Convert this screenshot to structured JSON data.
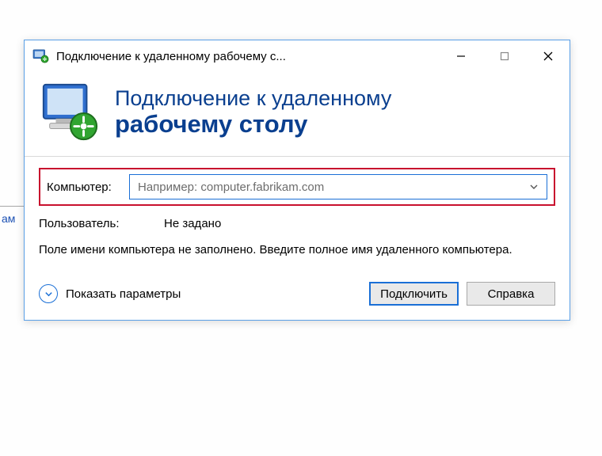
{
  "bg_fragment": "ам",
  "titlebar": {
    "title": "Подключение к удаленному рабочему с..."
  },
  "header": {
    "line1": "Подключение к удаленному",
    "line2": "рабочему столу"
  },
  "form": {
    "computer_label": "Компьютер:",
    "computer_placeholder": "Например: computer.fabrikam.com",
    "user_label": "Пользователь:",
    "user_value": "Не задано",
    "hint": "Поле имени компьютера не заполнено. Введите полное имя удаленного компьютера."
  },
  "footer": {
    "options_label": "Показать параметры",
    "connect_label": "Подключить",
    "help_label": "Справка"
  }
}
